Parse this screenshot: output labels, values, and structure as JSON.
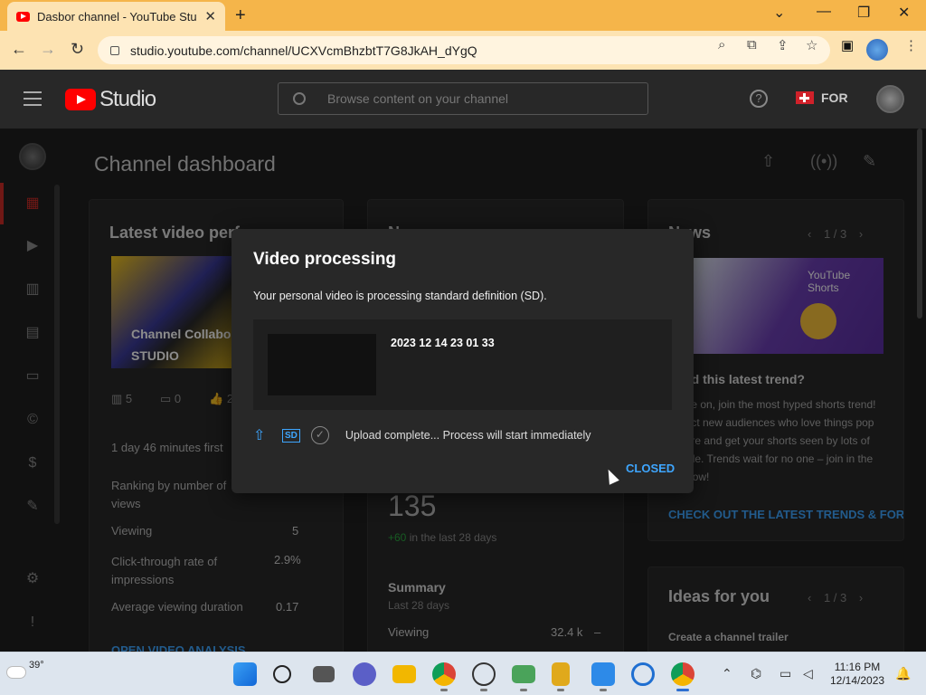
{
  "browser": {
    "tab_title": "Dasbor channel - YouTube Studio",
    "url": "studio.youtube.com/channel/UCXVcmBhzbtT7G8JkAH_dYgQ"
  },
  "header": {
    "logo_text": "Studio",
    "search_placeholder": "Browse content on your channel",
    "country_label": "FOR"
  },
  "main": {
    "title": "Channel dashboard",
    "latest": {
      "title": "Latest video performance",
      "thumb_caption_1": "Channel Collabora",
      "thumb_caption_2": "STUDIO",
      "views": "5",
      "comments": "0",
      "likes": "2",
      "first_label": "1 day 46 minutes first",
      "rank_label": "Ranking by number of views",
      "rows": [
        {
          "label": "Viewing",
          "value": "5"
        },
        {
          "label": "Click-through rate of impressions",
          "value": "2.9%"
        },
        {
          "label": "Average viewing duration",
          "value": "0.17"
        }
      ],
      "link": "OPEN VIDEO ANALYSIS"
    },
    "analytics": {
      "title": "Now",
      "subs": "135",
      "subs_change": "+60",
      "subs_period": "in the last 28 days",
      "summary_title": "Summary",
      "summary_period": "Last 28 days",
      "viewing_label": "Viewing",
      "viewing_value": "32.4 k",
      "viewing_trend": "–"
    },
    "news": {
      "title": "News",
      "pager": "1 / 3",
      "shorts_label": "YouTube Shorts",
      "headline": "Used this latest trend?",
      "body": "Come on, join the most hyped shorts trend! Attract new audiences who love things pop culture and get your shorts seen by lots of people. Trends wait for no one – join in the fun now!",
      "link": "CHECK OUT THE LATEST TRENDS & FOR"
    },
    "ideas": {
      "title": "Ideas for you",
      "pager": "1 / 3",
      "item": "Create a channel trailer"
    }
  },
  "dialog": {
    "title": "Video processing",
    "message": "Your personal video is processing standard definition (SD).",
    "video_name": "2023 12 14 23 01 33",
    "sd_label": "SD",
    "status": "Upload complete... Process will start immediately",
    "close_label": "CLOSED"
  },
  "taskbar": {
    "temp": "39°",
    "time": "11:16 PM",
    "date": "12/14/2023"
  }
}
